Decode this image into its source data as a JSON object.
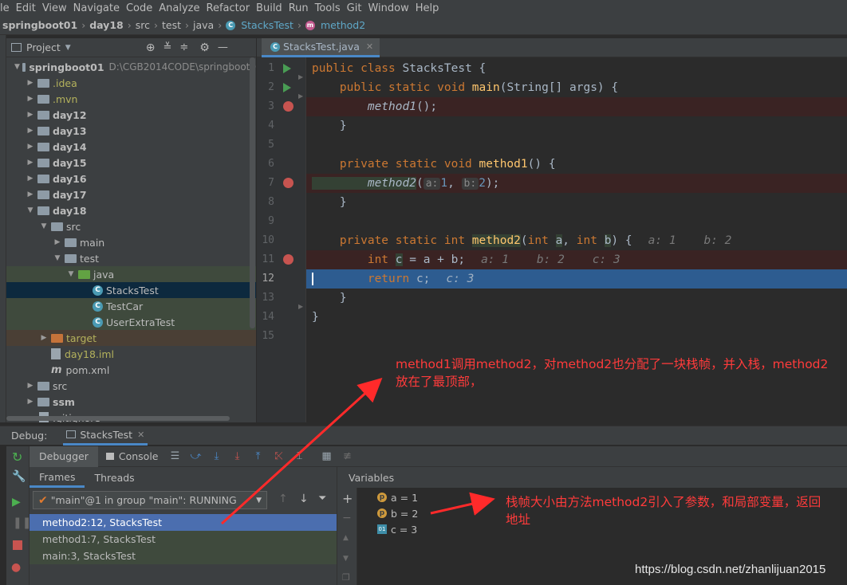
{
  "menu": [
    "le",
    "Edit",
    "View",
    "Navigate",
    "Code",
    "Analyze",
    "Refactor",
    "Build",
    "Run",
    "Tools",
    "Git",
    "Window",
    "Help"
  ],
  "nav": {
    "project": "springboot01",
    "module": "day18",
    "p1": "src",
    "p2": "test",
    "p3": "java",
    "cls": "StacksTest",
    "method": "method2"
  },
  "project_panel": {
    "title": "Project",
    "root": "springboot01",
    "root_path": "D:\\CGB2014CODE\\springboot0"
  },
  "tree": [
    {
      "label": ".idea",
      "color": "#b4b25c"
    },
    {
      "label": ".mvn",
      "color": "#b4b25c"
    },
    {
      "label": "day12",
      "color": "#bbbbbb"
    },
    {
      "label": "day13",
      "color": "#bbbbbb"
    },
    {
      "label": "day14",
      "color": "#bbbbbb"
    },
    {
      "label": "day15",
      "color": "#bbbbbb"
    },
    {
      "label": "day16",
      "color": "#bbbbbb"
    },
    {
      "label": "day17",
      "color": "#bbbbbb"
    },
    {
      "label": "day18",
      "color": "#bbbbbb"
    },
    {
      "label": "src",
      "color": "#bbbbbb"
    },
    {
      "label": "main",
      "color": "#bbbbbb"
    },
    {
      "label": "test",
      "color": "#bbbbbb"
    },
    {
      "label": "java",
      "color": "#bbbbbb"
    },
    {
      "label": "StacksTest",
      "color": "#bbbbbb"
    },
    {
      "label": "TestCar",
      "color": "#bbbbbb"
    },
    {
      "label": "UserExtraTest",
      "color": "#bbbbbb"
    },
    {
      "label": "target",
      "color": "#b4b25c"
    },
    {
      "label": "day18.iml",
      "color": "#b4b25c"
    },
    {
      "label": "pom.xml",
      "color": "#bbbbbb"
    },
    {
      "label": "src",
      "color": "#bbbbbb"
    },
    {
      "label": "ssm",
      "color": "#bbbbbb"
    },
    {
      "label": ".gitignore",
      "color": "#bbbbbb"
    }
  ],
  "editor": {
    "tab": "StacksTest.java",
    "line_numbers": [
      "1",
      "2",
      "3",
      "4",
      "5",
      "6",
      "7",
      "8",
      "9",
      "10",
      "11",
      "12",
      "13",
      "14",
      "15"
    ],
    "code": {
      "l1": {
        "a": "public class ",
        "b": "StacksTest {"
      },
      "l2": {
        "a": "    public static void ",
        "b": "main",
        "c": "(String[] args) {"
      },
      "l3": {
        "a": "        method1",
        "b": "();"
      },
      "l4": "    }",
      "l6": {
        "a": "    private static void ",
        "b": "method1",
        "c": "() {"
      },
      "l7": {
        "a": "        method2",
        "b": "(",
        "p1": "a:",
        "v1": "1",
        "c": ", ",
        "p2": "b:",
        "v2": "2",
        "d": ");"
      },
      "l8": "    }",
      "l10": {
        "a": "    private static int ",
        "b": "method2",
        "c": "(",
        "d": "int ",
        "e": "a",
        "f": ", ",
        "g": "int ",
        "h": "b",
        "i": ") {",
        "hint": "a: 1    b: 2"
      },
      "l11": {
        "a": "        int ",
        "b": "c",
        "c": " = a + b;",
        "hint": "a: 1    b: 2    c: 3"
      },
      "l12": {
        "a": "        return ",
        "b": "c;",
        "hint": "c: 3"
      },
      "l13": "    }",
      "l14": "}"
    }
  },
  "debug": {
    "label": "Debug:",
    "config": "StacksTest",
    "tabs": {
      "debugger": "Debugger",
      "console": "Console"
    },
    "frames_tab": "Frames",
    "threads_tab": "Threads",
    "thread": "\"main\"@1 in group \"main\": RUNNING",
    "frames": [
      "method2:12, StacksTest",
      "method1:7, StacksTest",
      "main:3, StacksTest"
    ],
    "variables_title": "Variables",
    "variables": [
      {
        "badge": "p",
        "text": "a = 1"
      },
      {
        "badge": "p",
        "text": "b = 2"
      },
      {
        "badge": "01",
        "text": "c = 3"
      }
    ]
  },
  "annotations": {
    "top_line1": "method1调用method2，对method2也分配了一块栈帧，并入栈，method2",
    "top_line2": "放在了最顶部，",
    "bottom_line1": "栈帧大小由方法method2引入了参数，和局部变量，返回",
    "bottom_line2": "地址"
  },
  "watermark": "https://blog.csdn.net/zhanlijuan2015",
  "colors": {
    "accent": "#4a88c7",
    "selection": "#2d5c90",
    "breakpoint": "#c75450",
    "annotation": "#ff3b3b"
  }
}
